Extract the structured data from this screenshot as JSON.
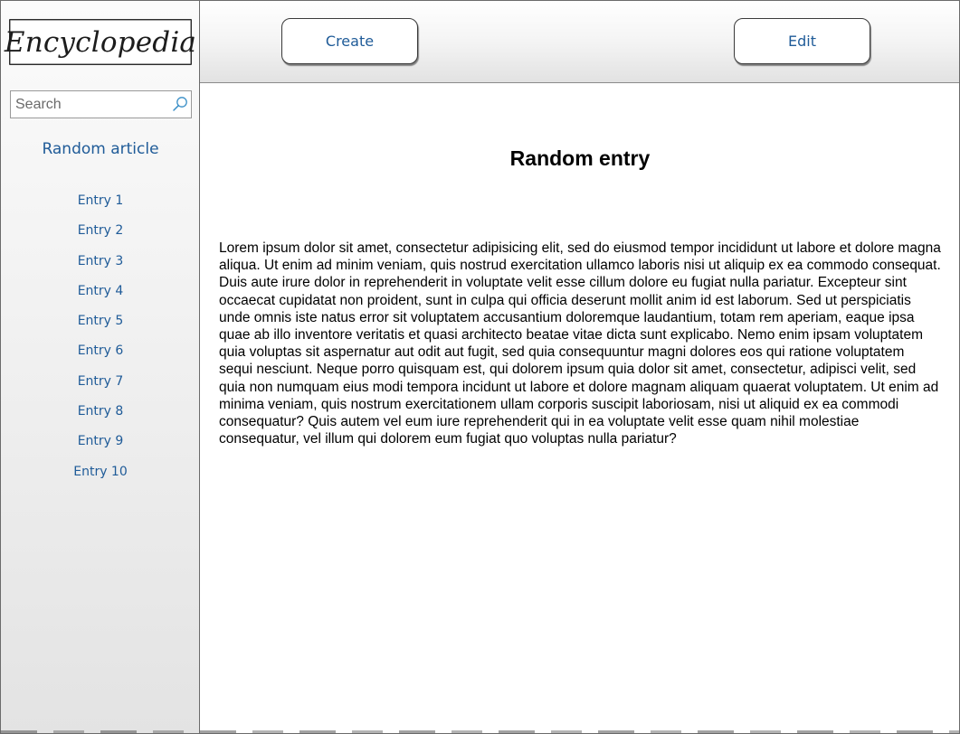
{
  "sidebar": {
    "logo_text": "Encyclopedia",
    "search": {
      "placeholder": "Search",
      "value": "",
      "icon": "search-icon"
    },
    "random_article_label": "Random article",
    "entries": [
      "Entry 1",
      "Entry 2",
      "Entry 3",
      "Entry 4",
      "Entry 5",
      "Entry 6",
      "Entry 7",
      "Entry 8",
      "Entry 9",
      "Entry 10"
    ]
  },
  "header": {
    "create_label": "Create",
    "edit_label": "Edit"
  },
  "main": {
    "title": "Random entry",
    "body": "Lorem ipsum dolor sit amet, consectetur adipisicing elit, sed do eiusmod tempor incididunt ut labore et dolore magna aliqua. Ut enim ad minim veniam, quis nostrud exercitation ullamco laboris nisi ut aliquip ex ea commodo consequat. Duis aute irure dolor in reprehenderit in voluptate velit esse cillum dolore eu fugiat nulla pariatur. Excepteur sint occaecat cupidatat non proident, sunt in culpa qui officia deserunt mollit anim id est laborum. Sed ut perspiciatis unde omnis iste natus error sit voluptatem accusantium doloremque laudantium, totam rem aperiam, eaque ipsa quae ab illo inventore veritatis et quasi architecto beatae vitae dicta sunt explicabo. Nemo enim ipsam voluptatem quia voluptas sit aspernatur aut odit aut fugit, sed quia consequuntur magni dolores eos qui ratione voluptatem sequi nesciunt. Neque porro quisquam est, qui dolorem ipsum quia dolor sit amet, consectetur, adipisci velit, sed quia non numquam eius modi tempora incidunt ut labore et dolore magnam aliquam quaerat voluptatem. Ut enim ad minima veniam, quis nostrum exercitationem ullam corporis suscipit laboriosam, nisi ut aliquid ex ea commodi consequatur? Quis autem vel eum iure reprehenderit qui in ea voluptate velit esse quam nihil molestiae consequatur, vel illum qui dolorem eum fugiat quo voluptas nulla pariatur?"
  },
  "colors": {
    "link": "#1f5b98",
    "border": "#6b6b6b",
    "search_icon": "#3a8fc7"
  }
}
